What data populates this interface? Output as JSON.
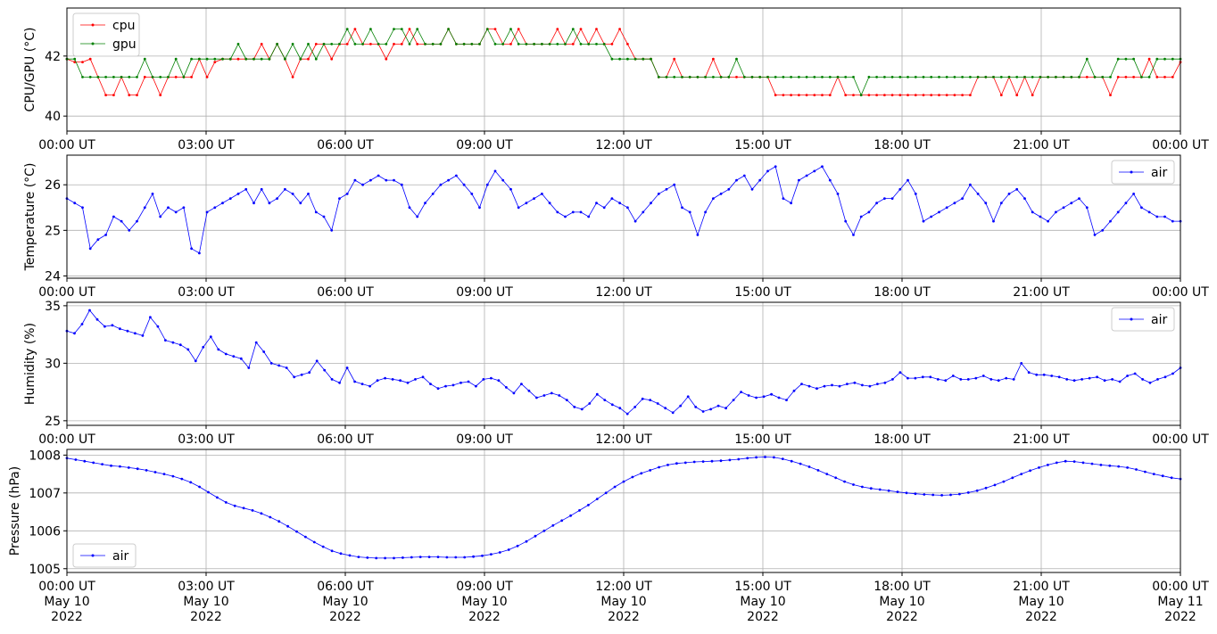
{
  "chart_data": [
    {
      "type": "line",
      "panel": "cpu-gpu",
      "ylabel": "CPU/GPU (°C)",
      "ylim": [
        39.5,
        43.6
      ],
      "yticks": [
        40,
        42
      ],
      "grid": true,
      "legend_position": "upper-left",
      "x_tick_labels": [
        "00:00 UT",
        "03:00 UT",
        "06:00 UT",
        "09:00 UT",
        "12:00 UT",
        "15:00 UT",
        "18:00 UT",
        "21:00 UT",
        "00:00 UT"
      ],
      "x_sampling_minutes": 10,
      "series": [
        {
          "name": "cpu",
          "color": "#ff0000",
          "values": [
            41.9,
            41.8,
            41.8,
            41.9,
            41.3,
            40.7,
            40.7,
            41.3,
            40.7,
            40.7,
            41.3,
            41.3,
            40.7,
            41.3,
            41.3,
            41.3,
            41.3,
            41.9,
            41.3,
            41.8,
            41.9,
            41.9,
            41.9,
            41.9,
            41.9,
            42.4,
            41.9,
            42.4,
            41.9,
            41.3,
            41.9,
            41.9,
            42.4,
            42.4,
            41.9,
            42.4,
            42.4,
            42.9,
            42.4,
            42.4,
            42.4,
            41.9,
            42.4,
            42.4,
            42.9,
            42.4,
            42.4,
            42.4,
            42.4,
            42.9,
            42.4,
            42.4,
            42.4,
            42.4,
            42.9,
            42.9,
            42.4,
            42.4,
            42.9,
            42.4,
            42.4,
            42.4,
            42.4,
            42.9,
            42.4,
            42.4,
            42.9,
            42.4,
            42.9,
            42.4,
            42.4,
            42.9,
            42.4,
            41.9,
            41.9,
            41.9,
            41.3,
            41.3,
            41.9,
            41.3,
            41.3,
            41.3,
            41.3,
            41.9,
            41.3,
            41.3,
            41.3,
            41.3,
            41.3,
            41.3,
            41.3,
            40.7,
            40.7,
            40.7,
            40.7,
            40.7,
            40.7,
            40.7,
            40.7,
            41.3,
            40.7,
            40.7,
            40.7,
            40.7,
            40.7,
            40.7,
            40.7,
            40.7,
            40.7,
            40.7,
            40.7,
            40.7,
            40.7,
            40.7,
            40.7,
            40.7,
            40.7,
            41.3,
            41.3,
            41.3,
            40.7,
            41.3,
            40.7,
            41.3,
            40.7,
            41.3,
            41.3,
            41.3,
            41.3,
            41.3,
            41.3,
            41.3,
            41.3,
            41.3,
            40.7,
            41.3,
            41.3,
            41.3,
            41.3,
            41.9,
            41.3,
            41.3,
            41.3,
            41.8
          ]
        },
        {
          "name": "gpu",
          "color": "#008000",
          "values": [
            41.9,
            41.9,
            41.3,
            41.3,
            41.3,
            41.3,
            41.3,
            41.3,
            41.3,
            41.3,
            41.9,
            41.3,
            41.3,
            41.3,
            41.9,
            41.3,
            41.9,
            41.9,
            41.9,
            41.9,
            41.9,
            41.9,
            42.4,
            41.9,
            41.9,
            41.9,
            41.9,
            42.4,
            41.9,
            42.4,
            41.9,
            42.4,
            41.9,
            42.4,
            42.4,
            42.4,
            42.9,
            42.4,
            42.4,
            42.9,
            42.4,
            42.4,
            42.9,
            42.9,
            42.4,
            42.9,
            42.4,
            42.4,
            42.4,
            42.9,
            42.4,
            42.4,
            42.4,
            42.4,
            42.9,
            42.4,
            42.4,
            42.9,
            42.4,
            42.4,
            42.4,
            42.4,
            42.4,
            42.4,
            42.4,
            42.9,
            42.4,
            42.4,
            42.4,
            42.4,
            41.9,
            41.9,
            41.9,
            41.9,
            41.9,
            41.9,
            41.3,
            41.3,
            41.3,
            41.3,
            41.3,
            41.3,
            41.3,
            41.3,
            41.3,
            41.3,
            41.9,
            41.3,
            41.3,
            41.3,
            41.3,
            41.3,
            41.3,
            41.3,
            41.3,
            41.3,
            41.3,
            41.3,
            41.3,
            41.3,
            41.3,
            41.3,
            40.7,
            41.3,
            41.3,
            41.3,
            41.3,
            41.3,
            41.3,
            41.3,
            41.3,
            41.3,
            41.3,
            41.3,
            41.3,
            41.3,
            41.3,
            41.3,
            41.3,
            41.3,
            41.3,
            41.3,
            41.3,
            41.3,
            41.3,
            41.3,
            41.3,
            41.3,
            41.3,
            41.3,
            41.3,
            41.9,
            41.3,
            41.3,
            41.3,
            41.9,
            41.9,
            41.9,
            41.3,
            41.3,
            41.9,
            41.9,
            41.9,
            41.9
          ]
        }
      ]
    },
    {
      "type": "line",
      "panel": "temperature",
      "ylabel": "Temperature (°C)",
      "ylim": [
        23.95,
        26.65
      ],
      "yticks": [
        24,
        25,
        26
      ],
      "grid": true,
      "legend_position": "upper-right",
      "x_tick_labels": [
        "00:00 UT",
        "03:00 UT",
        "06:00 UT",
        "09:00 UT",
        "12:00 UT",
        "15:00 UT",
        "18:00 UT",
        "21:00 UT",
        "00:00 UT"
      ],
      "x_sampling_minutes": 10,
      "series": [
        {
          "name": "air",
          "color": "#0000ff",
          "values": [
            25.7,
            25.6,
            25.5,
            24.6,
            24.8,
            24.9,
            25.3,
            25.2,
            25.0,
            25.2,
            25.5,
            25.8,
            25.3,
            25.5,
            25.4,
            25.5,
            24.6,
            24.5,
            25.4,
            25.5,
            25.6,
            25.7,
            25.8,
            25.9,
            25.6,
            25.9,
            25.6,
            25.7,
            25.9,
            25.8,
            25.6,
            25.8,
            25.4,
            25.3,
            25.0,
            25.7,
            25.8,
            26.1,
            26.0,
            26.1,
            26.2,
            26.1,
            26.1,
            26.0,
            25.5,
            25.3,
            25.6,
            25.8,
            26.0,
            26.1,
            26.2,
            26.0,
            25.8,
            25.5,
            26.0,
            26.3,
            26.1,
            25.9,
            25.5,
            25.6,
            25.7,
            25.8,
            25.6,
            25.4,
            25.3,
            25.4,
            25.4,
            25.3,
            25.6,
            25.5,
            25.7,
            25.6,
            25.5,
            25.2,
            25.4,
            25.6,
            25.8,
            25.9,
            26.0,
            25.5,
            25.4,
            24.9,
            25.4,
            25.7,
            25.8,
            25.9,
            26.1,
            26.2,
            25.9,
            26.1,
            26.3,
            26.4,
            25.7,
            25.6,
            26.1,
            26.2,
            26.3,
            26.4,
            26.1,
            25.8,
            25.2,
            24.9,
            25.3,
            25.4,
            25.6,
            25.7,
            25.7,
            25.9,
            26.1,
            25.8,
            25.2,
            25.3,
            25.4,
            25.5,
            25.6,
            25.7,
            26.0,
            25.8,
            25.6,
            25.2,
            25.6,
            25.8,
            25.9,
            25.7,
            25.4,
            25.3,
            25.2,
            25.4,
            25.5,
            25.6,
            25.7,
            25.5,
            24.9,
            25.0,
            25.2,
            25.4,
            25.6,
            25.8,
            25.5,
            25.4,
            25.3,
            25.3,
            25.2,
            25.2
          ]
        }
      ]
    },
    {
      "type": "line",
      "panel": "humidity",
      "ylabel": "Humidity (%)",
      "ylim": [
        24.6,
        35.3
      ],
      "yticks": [
        25,
        30,
        35
      ],
      "grid": true,
      "legend_position": "upper-right",
      "x_tick_labels": [
        "00:00 UT",
        "03:00 UT",
        "06:00 UT",
        "09:00 UT",
        "12:00 UT",
        "15:00 UT",
        "18:00 UT",
        "21:00 UT",
        "00:00 UT"
      ],
      "x_sampling_minutes": 10,
      "series": [
        {
          "name": "air",
          "color": "#0000ff",
          "values": [
            32.8,
            32.6,
            33.4,
            34.6,
            33.8,
            33.2,
            33.3,
            33.0,
            32.8,
            32.6,
            32.4,
            34.0,
            33.2,
            32.0,
            31.8,
            31.6,
            31.2,
            30.2,
            31.4,
            32.3,
            31.2,
            30.8,
            30.6,
            30.4,
            29.6,
            31.8,
            31.0,
            30.0,
            29.8,
            29.6,
            28.8,
            29.0,
            29.2,
            30.2,
            29.4,
            28.6,
            28.3,
            29.6,
            28.4,
            28.2,
            28.0,
            28.5,
            28.7,
            28.6,
            28.5,
            28.3,
            28.6,
            28.8,
            28.2,
            27.8,
            28.0,
            28.1,
            28.3,
            28.4,
            28.0,
            28.6,
            28.7,
            28.5,
            27.9,
            27.4,
            28.2,
            27.6,
            27.0,
            27.2,
            27.4,
            27.2,
            26.8,
            26.2,
            26.0,
            26.5,
            27.3,
            26.8,
            26.4,
            26.1,
            25.6,
            26.2,
            26.9,
            26.8,
            26.5,
            26.1,
            25.7,
            26.3,
            27.1,
            26.2,
            25.8,
            26.0,
            26.3,
            26.1,
            26.8,
            27.5,
            27.2,
            27.0,
            27.1,
            27.3,
            27.0,
            26.8,
            27.6,
            28.2,
            28.0,
            27.8,
            28.0,
            28.1,
            28.0,
            28.2,
            28.3,
            28.1,
            28.0,
            28.2,
            28.3,
            28.6,
            29.2,
            28.7,
            28.7,
            28.8,
            28.8,
            28.6,
            28.5,
            28.9,
            28.6,
            28.6,
            28.7,
            28.9,
            28.6,
            28.5,
            28.7,
            28.6,
            30.0,
            29.2,
            29.0,
            29.0,
            28.9,
            28.8,
            28.6,
            28.5,
            28.6,
            28.7,
            28.8,
            28.5,
            28.6,
            28.4,
            28.9,
            29.1,
            28.6,
            28.3,
            28.6,
            28.8,
            29.1,
            29.6
          ]
        }
      ]
    },
    {
      "type": "line",
      "panel": "pressure",
      "ylabel": "Pressure (hPa)",
      "ylim": [
        1004.9,
        1008.15
      ],
      "yticks": [
        1005,
        1006,
        1007,
        1008
      ],
      "grid": true,
      "legend_position": "lower-left",
      "x_tick_labels": [
        "00:00 UT\nMay 10\n2022",
        "03:00 UT\nMay 10\n2022",
        "06:00 UT\nMay 10\n2022",
        "09:00 UT\nMay 10\n2022",
        "12:00 UT\nMay 10\n2022",
        "15:00 UT\nMay 10\n2022",
        "18:00 UT\nMay 10\n2022",
        "21:00 UT\nMay 10\n2022",
        "00:00 UT\nMay 11\n2022"
      ],
      "x_sampling_minutes": 10,
      "series": [
        {
          "name": "air",
          "color": "#0000ff",
          "values": [
            1007.92,
            1007.88,
            1007.84,
            1007.8,
            1007.76,
            1007.72,
            1007.7,
            1007.67,
            1007.64,
            1007.6,
            1007.55,
            1007.5,
            1007.44,
            1007.37,
            1007.28,
            1007.16,
            1007.02,
            1006.88,
            1006.75,
            1006.66,
            1006.6,
            1006.54,
            1006.46,
            1006.36,
            1006.25,
            1006.12,
            1005.98,
            1005.84,
            1005.7,
            1005.58,
            1005.47,
            1005.4,
            1005.35,
            1005.31,
            1005.29,
            1005.28,
            1005.28,
            1005.28,
            1005.29,
            1005.3,
            1005.31,
            1005.31,
            1005.31,
            1005.3,
            1005.3,
            1005.3,
            1005.32,
            1005.34,
            1005.38,
            1005.43,
            1005.5,
            1005.6,
            1005.72,
            1005.86,
            1006.0,
            1006.14,
            1006.27,
            1006.4,
            1006.54,
            1006.68,
            1006.84,
            1007.0,
            1007.16,
            1007.3,
            1007.42,
            1007.52,
            1007.6,
            1007.68,
            1007.74,
            1007.78,
            1007.8,
            1007.82,
            1007.83,
            1007.84,
            1007.85,
            1007.87,
            1007.89,
            1007.92,
            1007.94,
            1007.95,
            1007.94,
            1007.9,
            1007.84,
            1007.77,
            1007.69,
            1007.6,
            1007.5,
            1007.4,
            1007.3,
            1007.22,
            1007.16,
            1007.12,
            1007.09,
            1007.06,
            1007.03,
            1007.0,
            1006.98,
            1006.96,
            1006.95,
            1006.94,
            1006.95,
            1006.97,
            1007.01,
            1007.06,
            1007.13,
            1007.21,
            1007.3,
            1007.4,
            1007.5,
            1007.59,
            1007.67,
            1007.74,
            1007.8,
            1007.84,
            1007.83,
            1007.8,
            1007.77,
            1007.74,
            1007.72,
            1007.7,
            1007.67,
            1007.62,
            1007.56,
            1007.5,
            1007.45,
            1007.4,
            1007.37
          ]
        }
      ]
    }
  ]
}
